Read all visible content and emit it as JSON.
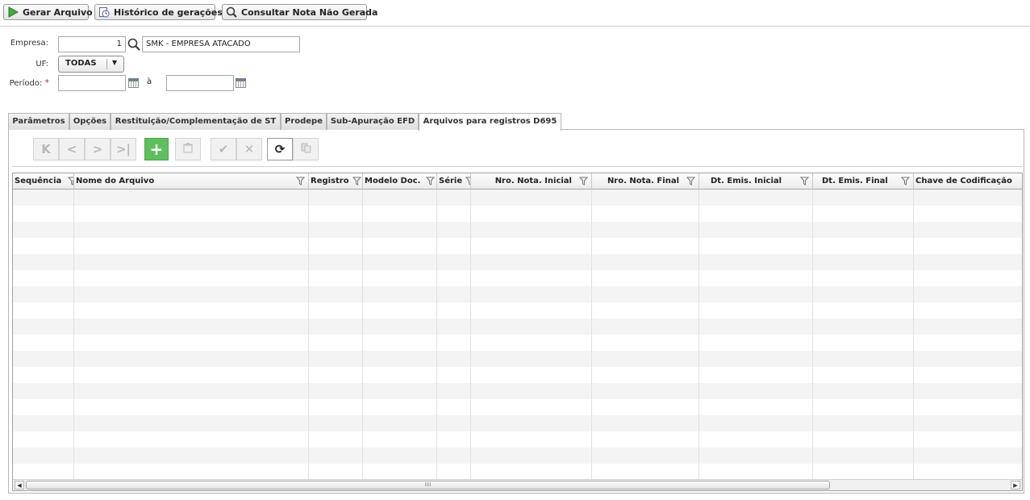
{
  "toolbar": {
    "gerar_label": "Gerar Arquivo",
    "historico_label": "Histórico de gerações",
    "consultar_label": "Consultar Nota Não Gerada"
  },
  "form": {
    "empresa_label": "Empresa:",
    "empresa_code": "1",
    "empresa_name": "SMK - EMPRESA ATACADO",
    "uf_label": "UF:",
    "uf_value": "TODAS",
    "periodo_label": "Período:",
    "periodo_required": "*",
    "periodo_sep": "à",
    "periodo_start": "",
    "periodo_end": ""
  },
  "tabs": [
    {
      "label": "Parâmetros"
    },
    {
      "label": "Opções"
    },
    {
      "label": "Restituição/Complementação de ST"
    },
    {
      "label": "Prodepe"
    },
    {
      "label": "Sub-Apuração EFD"
    },
    {
      "label": "Arquivos para registros D695"
    }
  ],
  "active_tab": "Arquivos para registros D695",
  "grid": {
    "columns": [
      {
        "label": "Sequência"
      },
      {
        "label": "Nome do Arquivo"
      },
      {
        "label": "Registro"
      },
      {
        "label": "Modelo Doc."
      },
      {
        "label": "Série"
      },
      {
        "label": "Nro. Nota. Inicial"
      },
      {
        "label": "Nro. Nota. Final"
      },
      {
        "label": "Dt. Emis. Inicial"
      },
      {
        "label": "Dt. Emis. Final"
      },
      {
        "label": "Chave de Codificação"
      }
    ],
    "rows": []
  },
  "colors": {
    "add_button": "#5fbf5f",
    "required_marker": "#d62020",
    "row_stripe": "#f4f4f4"
  }
}
